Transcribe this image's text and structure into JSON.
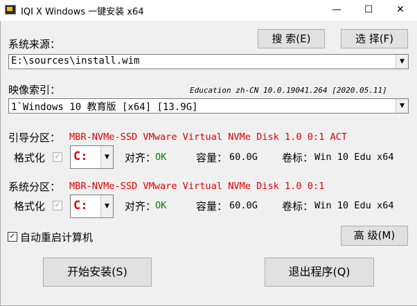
{
  "window": {
    "title": "IQI X Windows 一键安装  x64",
    "minimize": "—",
    "maximize": "☐",
    "close": "✕"
  },
  "source": {
    "label": "系统来源：",
    "path": "E:\\sources\\install.wim",
    "search_button": "搜 索(E)",
    "select_button": "选 择(F)"
  },
  "image": {
    "label": "映像索引：",
    "info": "Education zh-CN 10.0.19041.264 [2020.05.11]",
    "selected": "1`Windows 10 教育版 [x64] [13.9G]"
  },
  "boot": {
    "label": "引导分区：",
    "disk": "MBR-NVMe-SSD VMware Virtual NVMe Disk 1.0 0:1 ACT",
    "format_label": "格式化",
    "format_checked": true,
    "drive": "C:",
    "align_label": "对齐：",
    "align_value": "OK",
    "capacity_label": "容量：",
    "capacity_value": "60.0G",
    "volume_label": "卷标：",
    "volume_value": "Win 10 Edu x64"
  },
  "system": {
    "label": "系统分区：",
    "disk": "MBR-NVMe-SSD VMware Virtual NVMe Disk 1.0 0:1",
    "format_label": "格式化",
    "format_checked": true,
    "drive": "C:",
    "align_label": "对齐：",
    "align_value": "OK",
    "capacity_label": "容量：",
    "capacity_value": "60.0G",
    "volume_label": "卷标：",
    "volume_value": "Win 10 Edu x64"
  },
  "options": {
    "auto_restart_label": "自动重启计算机",
    "auto_restart_checked": true,
    "advanced_button": "高 级(M)"
  },
  "actions": {
    "start_button": "开始安装(S)",
    "exit_button": "退出程序(Q)"
  },
  "icons": {
    "checkmark": "✓",
    "dropdown": "▼"
  }
}
